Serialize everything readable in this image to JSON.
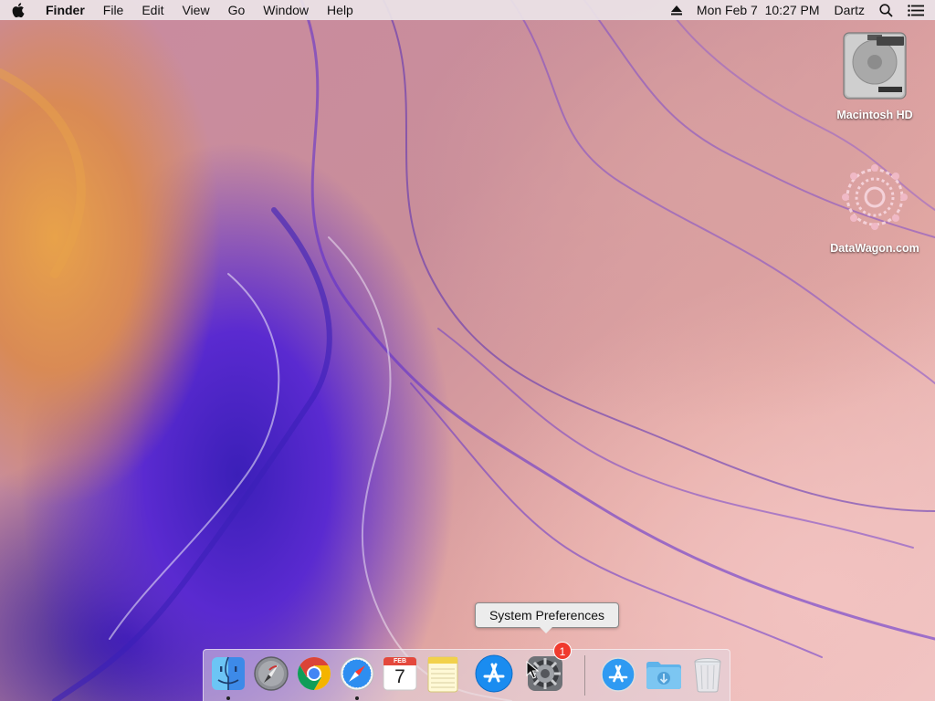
{
  "menubar": {
    "apple_icon": "apple-icon",
    "app_name": "Finder",
    "menus": [
      "File",
      "Edit",
      "View",
      "Go",
      "Window",
      "Help"
    ],
    "datetime": "Mon Feb 7  10:27 PM",
    "user": "Dartz",
    "icons": [
      "eject-icon",
      "search-icon",
      "list-icon"
    ]
  },
  "desktop": {
    "icons": [
      {
        "label": "Macintosh HD",
        "icon": "hard-drive-icon"
      },
      {
        "label": "DataWagon.com",
        "icon": "datawagon-logo-icon"
      }
    ]
  },
  "tooltip": {
    "text": "System Preferences"
  },
  "dock": {
    "apps": [
      {
        "name": "Finder",
        "icon": "finder-icon",
        "running": true
      },
      {
        "name": "Launchpad",
        "icon": "launchpad-icon",
        "running": false
      },
      {
        "name": "Google Chrome",
        "icon": "chrome-icon",
        "running": false
      },
      {
        "name": "Safari",
        "icon": "safari-icon",
        "running": true
      },
      {
        "name": "Calendar",
        "icon": "calendar-icon",
        "running": false,
        "month": "FEB",
        "day": "7"
      },
      {
        "name": "Notes",
        "icon": "notes-icon",
        "running": false
      },
      {
        "name": "App Store",
        "icon": "app-store-icon",
        "running": false
      },
      {
        "name": "System Preferences",
        "icon": "gear-icon",
        "running": false,
        "badge": "1"
      },
      {
        "name": "App Store",
        "icon": "app-store-icon",
        "running": false
      },
      {
        "name": "Downloads",
        "icon": "downloads-folder-icon",
        "running": false
      },
      {
        "name": "Trash",
        "icon": "trash-icon",
        "running": false
      }
    ]
  },
  "colors": {
    "menubar_bg": "#ece4e8",
    "badge": "#f03a2e",
    "tooltip_bg": "#ececec"
  }
}
